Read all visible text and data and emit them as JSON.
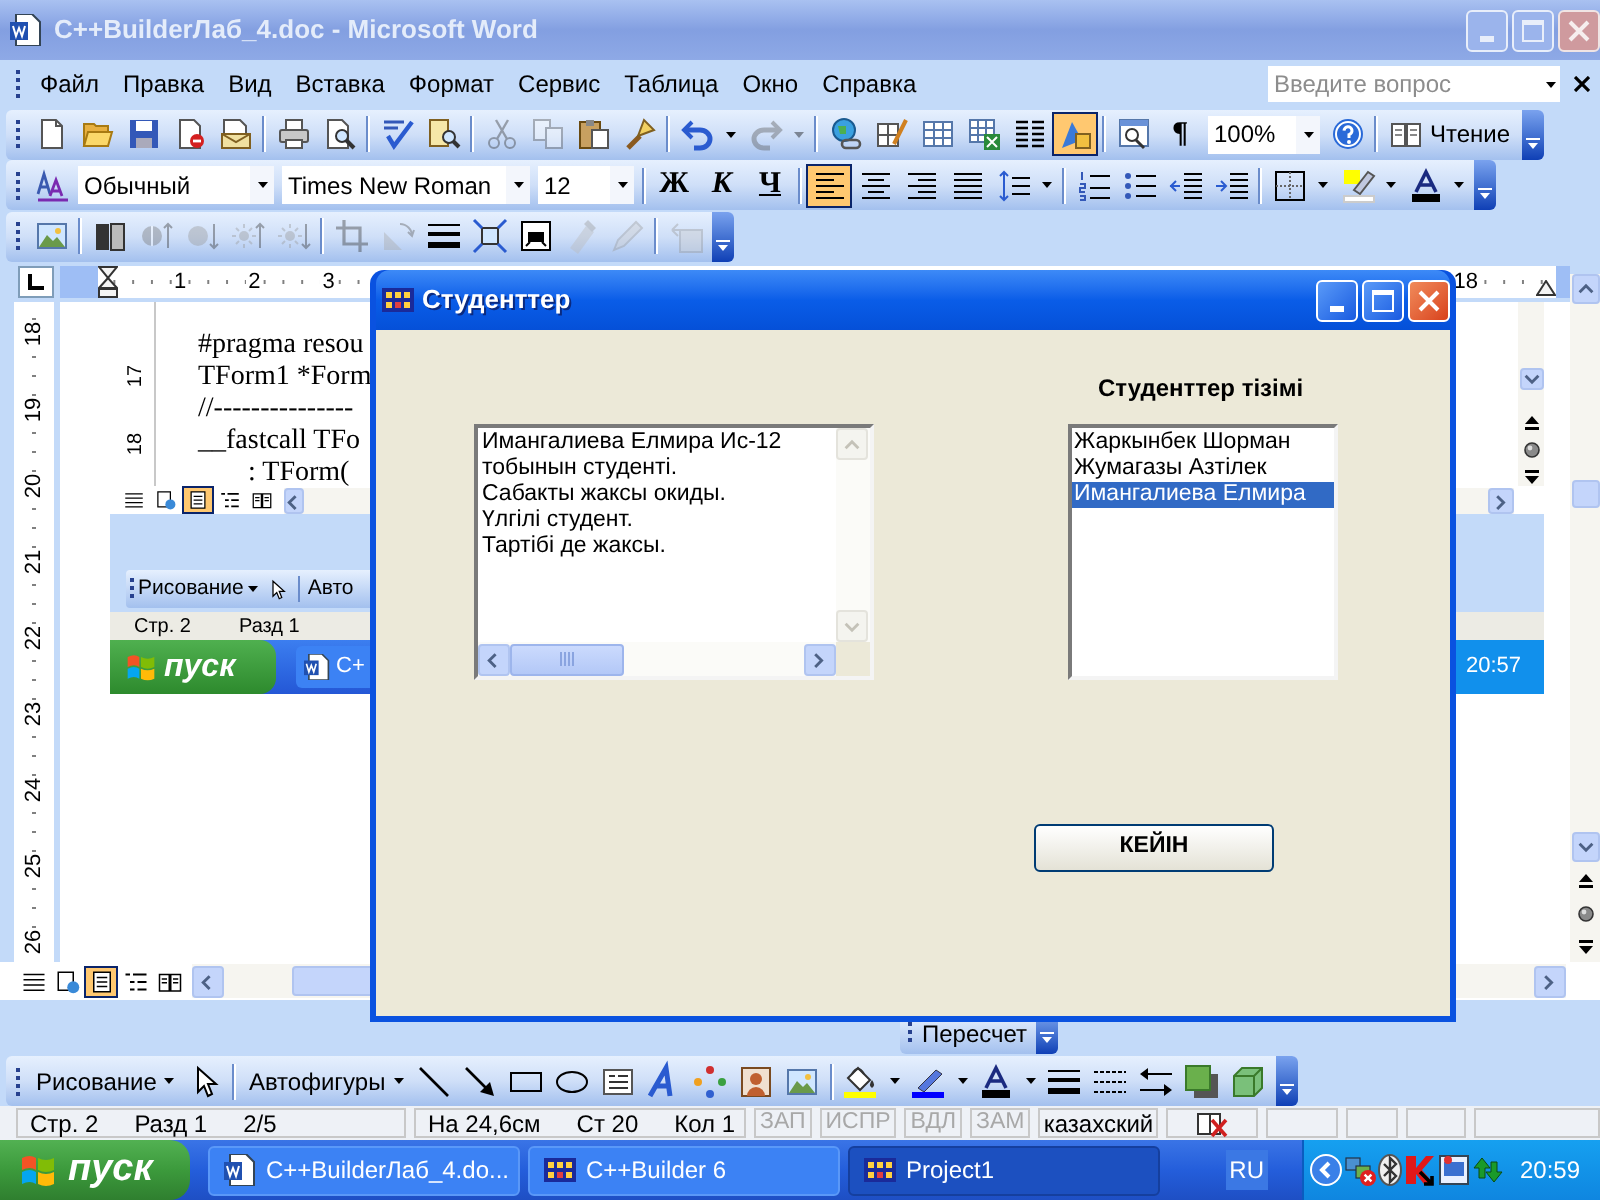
{
  "window": {
    "title": "C++BuilderЛаб_4.doc - Microsoft Word"
  },
  "menu": [
    "Файл",
    "Правка",
    "Вид",
    "Вставка",
    "Формат",
    "Сервис",
    "Таблица",
    "Окно",
    "Справка"
  ],
  "help_box": {
    "placeholder": "Введите вопрос"
  },
  "standard_toolbar": {
    "groups": [
      [
        {
          "kind": "new",
          "selected": false,
          "disabled": false
        },
        {
          "kind": "open",
          "selected": false,
          "disabled": false
        },
        {
          "kind": "save",
          "selected": false,
          "disabled": false
        },
        {
          "kind": "permission",
          "selected": false,
          "disabled": false
        },
        {
          "kind": "email",
          "selected": false,
          "disabled": false
        }
      ],
      [
        {
          "kind": "print",
          "selected": false,
          "disabled": false
        },
        {
          "kind": "preview",
          "selected": false,
          "disabled": false
        }
      ],
      [
        {
          "kind": "spelling",
          "selected": false,
          "disabled": false
        },
        {
          "kind": "research",
          "selected": false,
          "disabled": false
        }
      ],
      [
        {
          "kind": "cut",
          "selected": false,
          "disabled": true
        },
        {
          "kind": "copy",
          "selected": false,
          "disabled": true
        },
        {
          "kind": "paste",
          "selected": false,
          "disabled": false
        },
        {
          "kind": "painter",
          "selected": false,
          "disabled": false
        }
      ],
      [
        {
          "kind": "undo",
          "selected": false,
          "disabled": false
        },
        {
          "kind": "dropdown",
          "selected": false,
          "disabled": false
        },
        {
          "kind": "redo",
          "selected": false,
          "disabled": true
        },
        {
          "kind": "dropdown",
          "selected": false,
          "disabled": true
        }
      ],
      [
        {
          "kind": "hyperlink",
          "selected": false,
          "disabled": false
        },
        {
          "kind": "tables_borders",
          "selected": false,
          "disabled": false
        },
        {
          "kind": "insert_table",
          "selected": false,
          "disabled": false
        },
        {
          "kind": "insert_excel",
          "selected": false,
          "disabled": false
        },
        {
          "kind": "columns",
          "selected": false,
          "disabled": false
        },
        {
          "kind": "drawing",
          "selected": true,
          "disabled": false
        }
      ],
      [
        {
          "kind": "doc_map",
          "selected": false,
          "disabled": false
        },
        {
          "kind": "pilcrow",
          "label": "¶",
          "selected": false,
          "disabled": false
        },
        {
          "kind": "zoom_combo",
          "value": "100%"
        },
        {
          "kind": "help",
          "selected": false,
          "disabled": false
        }
      ],
      [
        {
          "kind": "reading",
          "label": "Чтение",
          "selected": false,
          "disabled": false
        }
      ]
    ]
  },
  "formatting_toolbar": {
    "groups": [
      [
        {
          "kind": "styles",
          "selected": false
        },
        {
          "kind": "style_combo",
          "value": "Обычный"
        },
        {
          "kind": "font_combo",
          "value": "Times New Roman"
        },
        {
          "kind": "size_combo",
          "value": "12"
        }
      ],
      [
        {
          "kind": "bold",
          "label": "Ж",
          "selected": false
        },
        {
          "kind": "italic",
          "label": "К",
          "selected": false
        },
        {
          "kind": "underline",
          "label": "Ч",
          "selected": false
        }
      ],
      [
        {
          "kind": "align_left",
          "selected": true
        },
        {
          "kind": "align_center",
          "selected": false
        },
        {
          "kind": "align_right",
          "selected": false
        },
        {
          "kind": "justify",
          "selected": false
        },
        {
          "kind": "line_spacing",
          "selected": false
        },
        {
          "kind": "dropdown",
          "selected": false
        }
      ],
      [
        {
          "kind": "numbering",
          "selected": false
        },
        {
          "kind": "bullets",
          "selected": false
        },
        {
          "kind": "outdent",
          "selected": false
        },
        {
          "kind": "indent",
          "selected": false
        }
      ],
      [
        {
          "kind": "borders",
          "selected": false
        },
        {
          "kind": "dropdown",
          "selected": false
        },
        {
          "kind": "highlight",
          "selected": false
        },
        {
          "kind": "dropdown",
          "selected": false
        },
        {
          "kind": "font_color",
          "selected": false
        },
        {
          "kind": "dropdown",
          "selected": false
        }
      ]
    ]
  },
  "picture_toolbar": {
    "groups": [
      [
        {
          "kind": "insert_picture",
          "disabled": false
        }
      ],
      [
        {
          "kind": "image_color",
          "disabled": false
        },
        {
          "kind": "more_contrast",
          "disabled": true
        },
        {
          "kind": "less_contrast",
          "disabled": true
        },
        {
          "kind": "more_brightness",
          "disabled": true
        },
        {
          "kind": "less_brightness",
          "disabled": true
        }
      ],
      [
        {
          "kind": "crop",
          "disabled": true
        },
        {
          "kind": "rotate",
          "disabled": true
        },
        {
          "kind": "line_style",
          "disabled": false
        },
        {
          "kind": "compress",
          "disabled": false
        },
        {
          "kind": "text_wrap",
          "disabled": false
        },
        {
          "kind": "format_picture",
          "disabled": true
        },
        {
          "kind": "transparent",
          "disabled": true
        }
      ],
      [
        {
          "kind": "reset_picture",
          "disabled": true
        }
      ]
    ]
  },
  "ruler": {
    "numbers": [
      "1",
      "2",
      "3"
    ],
    "right_numbers": [
      "18"
    ]
  },
  "vertical_ruler": {
    "numbers": [
      "18",
      "19",
      "20",
      "21",
      "22",
      "23",
      "24",
      "25",
      "26"
    ]
  },
  "embedded_screenshot": {
    "ruler_numbers": [
      "17",
      "18"
    ],
    "code_lines": [
      {
        "text": "#pragma resou"
      },
      {
        "text": "TForm1 *Form"
      },
      {
        "text": "//---------------"
      },
      {
        "text": "__fastcall TFo",
        "children": [
          {
            "text": ": TForm("
          }
        ]
      }
    ],
    "view_buttons": [
      {
        "kind": "normal",
        "selected": false
      },
      {
        "kind": "web",
        "selected": false
      },
      {
        "kind": "print",
        "selected": true
      },
      {
        "kind": "outline",
        "selected": false
      },
      {
        "kind": "reading",
        "selected": false
      }
    ],
    "drawing_menu": "Рисование",
    "autoshapes": "Авто",
    "status": [
      "Стр. 2",
      "Разд 1"
    ],
    "start": "пуск",
    "task": "C+",
    "clock": "20:57"
  },
  "dialog": {
    "title": "Студенттер",
    "memo_lines": [
      "Имангалиева Елмира Ис-12",
      "тобынын студенті.",
      "Сабакты жаксы окиды.",
      "Үлгілі студент.",
      "Тартібі де жаксы."
    ],
    "list_label": "Студенттер тізімі",
    "list": [
      {
        "text": "Жаркынбек Шорман",
        "selected": false
      },
      {
        "text": "Жумагазы Азтілек",
        "selected": false
      },
      {
        "text": "Имангалиева Елмира",
        "selected": true
      }
    ],
    "button": "КЕЙІН"
  },
  "view_buttons": [
    {
      "kind": "normal",
      "selected": false
    },
    {
      "kind": "web",
      "selected": false
    },
    {
      "kind": "print",
      "selected": true
    },
    {
      "kind": "outline",
      "selected": false
    },
    {
      "kind": "reading",
      "selected": false
    }
  ],
  "recalc_toolbar": {
    "label": "Пересчет"
  },
  "drawing_toolbar": {
    "groups": [
      [
        {
          "kind": "menu",
          "label": "Рисование"
        },
        {
          "kind": "pointer"
        }
      ],
      [
        {
          "kind": "menu",
          "label": "Автофигуры"
        },
        {
          "kind": "line"
        },
        {
          "kind": "arrow"
        },
        {
          "kind": "rectangle"
        },
        {
          "kind": "oval"
        },
        {
          "kind": "textbox"
        },
        {
          "kind": "wordart"
        },
        {
          "kind": "diagram"
        },
        {
          "kind": "clipart"
        },
        {
          "kind": "picture"
        }
      ],
      [
        {
          "kind": "fill_color"
        },
        {
          "kind": "dropdown"
        },
        {
          "kind": "line_color"
        },
        {
          "kind": "dropdown"
        },
        {
          "kind": "font_color"
        },
        {
          "kind": "dropdown"
        },
        {
          "kind": "line_style"
        },
        {
          "kind": "dash_style"
        },
        {
          "kind": "arrow_style"
        },
        {
          "kind": "shadow"
        },
        {
          "kind": "threed"
        }
      ]
    ]
  },
  "status_bar": {
    "panels": [
      [
        "Стр. 2",
        "Разд 1",
        "2/5"
      ],
      [
        "На 24,6см",
        "Ст 20",
        "Кол 1"
      ]
    ],
    "modes": [
      {
        "label": "ЗАП",
        "active": false
      },
      {
        "label": "ИСПР",
        "active": false
      },
      {
        "label": "ВДЛ",
        "active": false
      },
      {
        "label": "ЗАМ",
        "active": false
      }
    ],
    "language": "казахский"
  },
  "taskbar": {
    "start": "пуск",
    "tasks": [
      {
        "kind": "word",
        "label": "C++BuilderЛаб_4.do...",
        "selected": false
      },
      {
        "kind": "builder",
        "label": "C++Builder 6",
        "selected": false
      },
      {
        "kind": "form",
        "label": "Project1",
        "selected": true
      }
    ],
    "language": "RU",
    "clock": "20:59"
  }
}
